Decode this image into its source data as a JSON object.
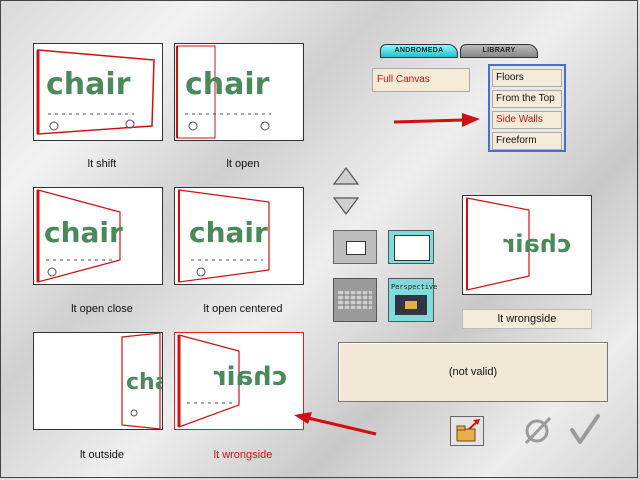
{
  "thumbnails": [
    {
      "caption": "lt shift"
    },
    {
      "caption": "lt open"
    },
    {
      "caption": "lt open close"
    },
    {
      "caption": "lt open centered"
    },
    {
      "caption": "lt outside"
    },
    {
      "caption": "lt wrongside"
    }
  ],
  "thumb_word": "chair",
  "tabs": {
    "active": "ANDROMEDA",
    "inactive": "LIBRARY"
  },
  "canvas_mode": "Full Canvas",
  "projection_menu": {
    "items": [
      "Floors",
      "From the Top",
      "Side Walls",
      "Freeform"
    ],
    "highlighted": "Side Walls"
  },
  "perspective_button": "Perspective",
  "preview": {
    "label": "lt wrongside"
  },
  "status_text": "(not valid)",
  "colors": {
    "accent": "#d01010",
    "menu_border": "#4a6cd0",
    "panel": "#f4ead8"
  }
}
